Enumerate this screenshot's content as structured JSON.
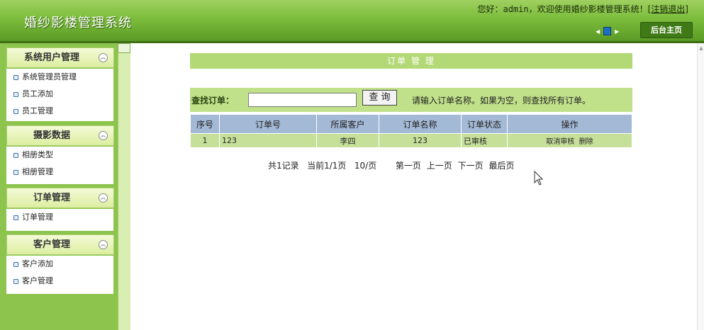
{
  "header": {
    "app_title": "婚纱影楼管理系统",
    "welcome_prefix": "您好：",
    "username": "admin",
    "welcome_suffix": "，欢迎使用婚纱影楼管理系统！",
    "logout_label": "[注销退出]",
    "home_button": "后台主页"
  },
  "sidebar": {
    "groups": [
      {
        "title": "系统用户管理",
        "items": [
          "系统管理员管理",
          "员工添加",
          "员工管理"
        ]
      },
      {
        "title": "摄影数据",
        "items": [
          "相册类型",
          "相册管理"
        ]
      },
      {
        "title": "订单管理",
        "items": [
          "订单管理"
        ]
      },
      {
        "title": "客户管理",
        "items": [
          "客户添加",
          "客户管理"
        ]
      }
    ]
  },
  "main": {
    "panel_title": "订单 管 理",
    "search": {
      "label": "查找订单：",
      "value": "",
      "button": "查 询",
      "hint": "请输入订单名称。如果为空，则查找所有订单。"
    },
    "table": {
      "headers": [
        "序号",
        "订单号",
        "所属客户",
        "订单名称",
        "订单状态",
        "操作"
      ],
      "rows": [
        {
          "index": "1",
          "order_no": "123",
          "customer": "李四",
          "order_name": "123",
          "status": "已审核",
          "actions": [
            "取消审核",
            "删除"
          ]
        }
      ]
    },
    "pager": {
      "total": "共1记录",
      "current": "当前1/1页",
      "per_page": "10/页",
      "first": "第一页",
      "prev": "上一页",
      "next": "下一页",
      "last": "最后页"
    }
  },
  "colors": {
    "header_green": "#7cbd3c",
    "sidebar_green": "#8dc44e",
    "table_header": "#a4b9d6",
    "table_row": "#c6e09a"
  }
}
